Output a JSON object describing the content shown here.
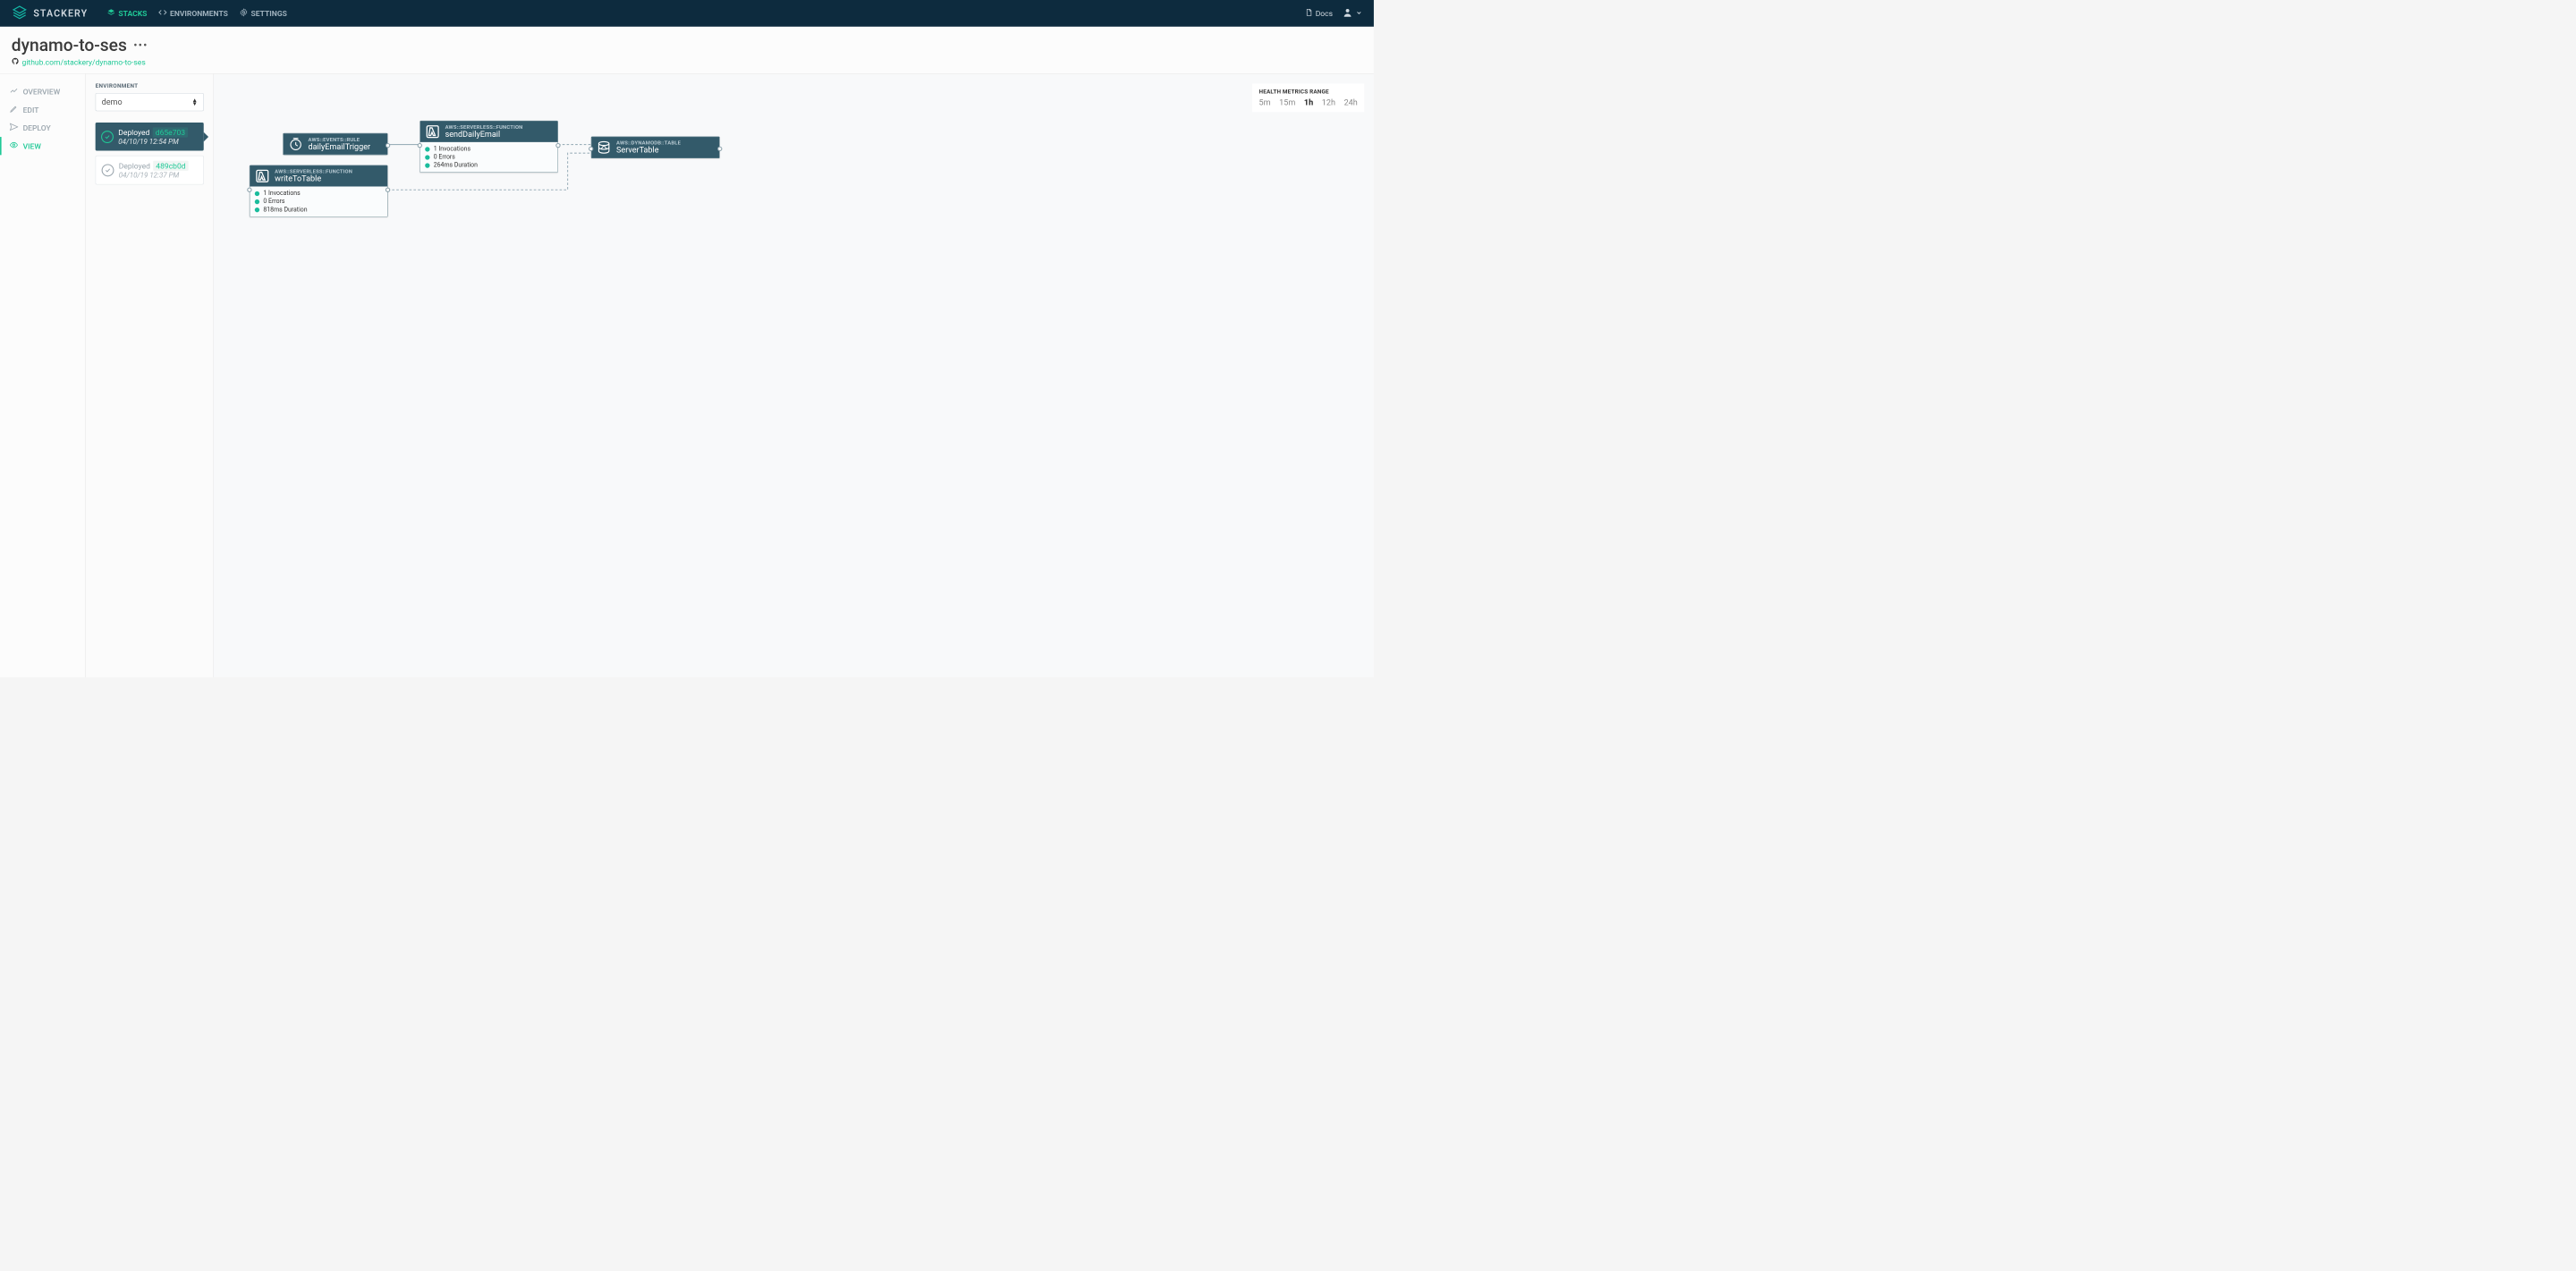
{
  "nav": {
    "brand": "STACKERY",
    "items": [
      {
        "label": "STACKS",
        "icon": "stacks-icon",
        "active": true
      },
      {
        "label": "ENVIRONMENTS",
        "icon": "code-icon",
        "active": false
      },
      {
        "label": "SETTINGS",
        "icon": "gear-icon",
        "active": false
      }
    ],
    "right": {
      "docs": "Docs"
    }
  },
  "header": {
    "title": "dynamo-to-ses",
    "repo": "github.com/stackery/dynamo-to-ses"
  },
  "sidebar": {
    "tabs": [
      {
        "label": "OVERVIEW",
        "icon": "overview-icon"
      },
      {
        "label": "EDIT",
        "icon": "pencil-icon"
      },
      {
        "label": "DEPLOY",
        "icon": "send-icon"
      },
      {
        "label": "VIEW",
        "icon": "eye-icon",
        "active": true
      }
    ]
  },
  "env_panel": {
    "label": "ENVIRONMENT",
    "selected": "demo",
    "deployments": [
      {
        "status": "Deployed",
        "hash": "d65e703",
        "timestamp": "04/10/19 12:54 PM",
        "active": true
      },
      {
        "status": "Deployed",
        "hash": "489cb0d",
        "timestamp": "04/10/19 12:37 PM",
        "active": false
      }
    ]
  },
  "metrics": {
    "label": "HEALTH METRICS RANGE",
    "ranges": [
      "5m",
      "15m",
      "1h",
      "12h",
      "24h"
    ],
    "active": "1h"
  },
  "nodes": {
    "dailyEmailTrigger": {
      "type": "AWS::EVENTS::RULE",
      "name": "dailyEmailTrigger"
    },
    "writeToTable": {
      "type": "AWS::SERVERLESS::FUNCTION",
      "name": "writeToTable",
      "metrics": [
        "1 Invocations",
        "0 Errors",
        "818ms Duration"
      ]
    },
    "sendDailyEmail": {
      "type": "AWS::SERVERLESS::FUNCTION",
      "name": "sendDailyEmail",
      "metrics": [
        "1 Invocations",
        "0 Errors",
        "264ms Duration"
      ]
    },
    "ServerTable": {
      "type": "AWS::DYNAMODB::TABLE",
      "name": "ServerTable"
    }
  }
}
